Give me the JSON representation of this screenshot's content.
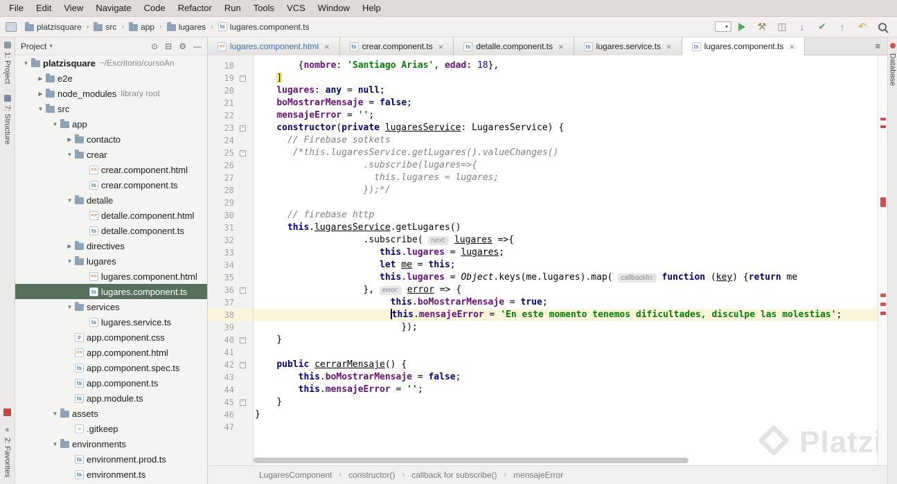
{
  "menu_bar": {
    "items": [
      "File",
      "Edit",
      "View",
      "Navigate",
      "Code",
      "Refactor",
      "Run",
      "Tools",
      "VCS",
      "Window",
      "Help"
    ]
  },
  "nav_bar": {
    "breadcrumbs": [
      {
        "label": "platzisquare",
        "icon": "folder"
      },
      {
        "label": "src",
        "icon": "folder"
      },
      {
        "label": "app",
        "icon": "folder"
      },
      {
        "label": "lugares",
        "icon": "folder"
      },
      {
        "label": "lugares.component.ts",
        "icon": "ts"
      }
    ],
    "toolbar_icons": [
      "run-config-dropdown",
      "run",
      "build-hammer",
      "open-recent",
      "vcs-update",
      "vcs-commit",
      "vcs-push",
      "rollback",
      "search-everywhere"
    ]
  },
  "left_stripe": {
    "top": [
      {
        "id": "project",
        "label": "1: Project"
      },
      {
        "id": "structure",
        "label": "7: Structure"
      }
    ],
    "bottom": [
      {
        "id": "npm",
        "label": ""
      },
      {
        "id": "favorites",
        "label": "2: Favorites"
      }
    ]
  },
  "right_stripe": {
    "top": [
      {
        "id": "database",
        "label": "Database"
      }
    ]
  },
  "project_panel": {
    "title": "Project",
    "header_icons": [
      "locate",
      "collapse-all",
      "settings-gear",
      "hide"
    ],
    "tree": [
      {
        "label": "platzisquare",
        "suffix": "~/Escritorio/cursoAn",
        "depth": 0,
        "icon": "folder",
        "arrow": "open",
        "bold": true
      },
      {
        "label": "e2e",
        "depth": 1,
        "icon": "folder",
        "arrow": "closed"
      },
      {
        "label": "node_modules",
        "suffix": "library root",
        "depth": 1,
        "icon": "folder",
        "arrow": "closed"
      },
      {
        "label": "src",
        "depth": 1,
        "icon": "folder",
        "arrow": "open"
      },
      {
        "label": "app",
        "depth": 2,
        "icon": "folder",
        "arrow": "open"
      },
      {
        "label": "contacto",
        "depth": 3,
        "icon": "folder",
        "arrow": "closed"
      },
      {
        "label": "crear",
        "depth": 3,
        "icon": "folder",
        "arrow": "open"
      },
      {
        "label": "crear.component.html",
        "depth": 4,
        "icon": "html"
      },
      {
        "label": "crear.component.ts",
        "depth": 4,
        "icon": "ts"
      },
      {
        "label": "detalle",
        "depth": 3,
        "icon": "folder",
        "arrow": "open"
      },
      {
        "label": "detalle.component.html",
        "depth": 4,
        "icon": "html"
      },
      {
        "label": "detalle.component.ts",
        "depth": 4,
        "icon": "ts"
      },
      {
        "label": "directives",
        "depth": 3,
        "icon": "folder",
        "arrow": "closed"
      },
      {
        "label": "lugares",
        "depth": 3,
        "icon": "folder",
        "arrow": "open"
      },
      {
        "label": "lugares.component.html",
        "depth": 4,
        "icon": "html"
      },
      {
        "label": "lugares.component.ts",
        "depth": 4,
        "icon": "ts",
        "selected": true
      },
      {
        "label": "services",
        "depth": 3,
        "icon": "folder",
        "arrow": "open"
      },
      {
        "label": "lugares.service.ts",
        "depth": 4,
        "icon": "ts"
      },
      {
        "label": "app.component.css",
        "depth": 3,
        "icon": "css"
      },
      {
        "label": "app.component.html",
        "depth": 3,
        "icon": "html"
      },
      {
        "label": "app.component.spec.ts",
        "depth": 3,
        "icon": "ts"
      },
      {
        "label": "app.component.ts",
        "depth": 3,
        "icon": "ts"
      },
      {
        "label": "app.module.ts",
        "depth": 3,
        "icon": "ts"
      },
      {
        "label": "assets",
        "depth": 2,
        "icon": "folder",
        "arrow": "open"
      },
      {
        "label": ".gitkeep",
        "depth": 3,
        "icon": "file"
      },
      {
        "label": "environments",
        "depth": 2,
        "icon": "folder",
        "arrow": "open"
      },
      {
        "label": "environment.prod.ts",
        "depth": 3,
        "icon": "ts"
      },
      {
        "label": "environment.ts",
        "depth": 3,
        "icon": "ts"
      }
    ]
  },
  "editor_tabs": [
    {
      "label": "lugares.component.html",
      "icon": "html",
      "modified": true,
      "active": false
    },
    {
      "label": "crear.component.ts",
      "icon": "ts",
      "modified": false,
      "active": false
    },
    {
      "label": "detalle.component.ts",
      "icon": "ts",
      "modified": false,
      "active": false
    },
    {
      "label": "lugares.service.ts",
      "icon": "ts",
      "modified": false,
      "active": false
    },
    {
      "label": "lugares.component.ts",
      "icon": "ts",
      "modified": false,
      "active": true
    }
  ],
  "editor": {
    "first_line": 18,
    "current_line": 38,
    "fold_marker_lines": [
      19,
      23,
      25,
      36,
      40,
      42,
      45
    ],
    "stripe_marks": [
      {
        "t": 90,
        "h": 4
      },
      {
        "t": 101,
        "h": 4
      },
      {
        "t": 205,
        "h": 14
      },
      {
        "t": 344,
        "h": 5
      },
      {
        "t": 357,
        "h": 5
      },
      {
        "t": 370,
        "h": 5
      }
    ],
    "lines": [
      {
        "n": 18,
        "i": 8,
        "t": [
          [
            "{",
            ""
          ],
          [
            "nombre",
            "f"
          ],
          [
            ": ",
            ""
          ],
          [
            "'Santiago Arias'",
            "s"
          ],
          [
            ", ",
            ""
          ],
          [
            "edad",
            "f"
          ],
          [
            ": ",
            ""
          ],
          [
            "18",
            "n"
          ],
          [
            "},",
            ""
          ]
        ]
      },
      {
        "n": 19,
        "i": 4,
        "t": [
          [
            "]",
            "m"
          ]
        ]
      },
      {
        "n": 20,
        "i": 4,
        "t": [
          [
            "lugares",
            "f"
          ],
          [
            ": ",
            ""
          ],
          [
            "any",
            "k"
          ],
          [
            " = ",
            ""
          ],
          [
            "null",
            "k"
          ],
          [
            ";",
            ""
          ]
        ]
      },
      {
        "n": 21,
        "i": 4,
        "t": [
          [
            "boMostrarMensaje",
            "f"
          ],
          [
            " = ",
            ""
          ],
          [
            "false",
            "k"
          ],
          [
            ";",
            ""
          ]
        ]
      },
      {
        "n": 22,
        "i": 4,
        "t": [
          [
            "mensajeError",
            "f"
          ],
          [
            " = ",
            ""
          ],
          [
            "''",
            "s"
          ],
          [
            ";",
            ""
          ]
        ]
      },
      {
        "n": 23,
        "i": 4,
        "t": [
          [
            "constructor",
            "k"
          ],
          [
            "(",
            ""
          ],
          [
            "private ",
            "k"
          ],
          [
            "lugaresService",
            "u"
          ],
          [
            ": LugaresService) {",
            ""
          ]
        ]
      },
      {
        "n": 24,
        "i": 6,
        "t": [
          [
            "// Firebase sotkets",
            "c"
          ]
        ]
      },
      {
        "n": 25,
        "i": 7,
        "t": [
          [
            "/*this.lugaresService.getLugares().valueChanges()",
            "c"
          ]
        ]
      },
      {
        "n": 26,
        "i": 20,
        "t": [
          [
            ".subscribe(lugares=>{",
            "c"
          ]
        ]
      },
      {
        "n": 27,
        "i": 22,
        "t": [
          [
            "this.lugares = lugares;",
            "c"
          ]
        ]
      },
      {
        "n": 28,
        "i": 20,
        "t": [
          [
            "});*/",
            "c"
          ]
        ]
      },
      {
        "n": 29,
        "i": 0,
        "t": []
      },
      {
        "n": 30,
        "i": 6,
        "t": [
          [
            "// firebase http",
            "c"
          ]
        ]
      },
      {
        "n": 31,
        "i": 6,
        "t": [
          [
            "this",
            "k"
          ],
          [
            ".",
            ""
          ],
          [
            "lugaresService",
            "u"
          ],
          [
            ".getLugares()",
            ""
          ]
        ]
      },
      {
        "n": 32,
        "i": 20,
        "t": [
          [
            ".subscribe( ",
            ""
          ],
          [
            "next:",
            "h"
          ],
          [
            " ",
            ""
          ],
          [
            "lugares",
            "u"
          ],
          [
            " =>{",
            ""
          ]
        ]
      },
      {
        "n": 33,
        "i": 23,
        "t": [
          [
            "this",
            "k"
          ],
          [
            ".",
            ""
          ],
          [
            "lugares",
            "f"
          ],
          [
            " = ",
            ""
          ],
          [
            "lugares",
            "u"
          ],
          [
            ";",
            ""
          ]
        ]
      },
      {
        "n": 34,
        "i": 23,
        "t": [
          [
            "let ",
            "k"
          ],
          [
            "me",
            "u"
          ],
          [
            " = ",
            ""
          ],
          [
            "this",
            "k"
          ],
          [
            ";",
            ""
          ]
        ]
      },
      {
        "n": 35,
        "i": 23,
        "t": [
          [
            "this",
            "k"
          ],
          [
            ".",
            ""
          ],
          [
            "lugares",
            "f"
          ],
          [
            " = ",
            ""
          ],
          [
            "Object",
            "i"
          ],
          [
            ".keys(me.lugares).map( ",
            ""
          ],
          [
            "callbackfn:",
            "h"
          ],
          [
            " ",
            ""
          ],
          [
            "function",
            "k"
          ],
          [
            " (",
            ""
          ],
          [
            "key",
            "u"
          ],
          [
            ") {",
            ""
          ],
          [
            "return",
            "k"
          ],
          [
            " me",
            ""
          ]
        ]
      },
      {
        "n": 36,
        "i": 20,
        "t": [
          [
            "}, ",
            ""
          ],
          [
            "error:",
            "h"
          ],
          [
            " ",
            ""
          ],
          [
            "error",
            "u"
          ],
          [
            " => {",
            ""
          ]
        ]
      },
      {
        "n": 37,
        "i": 25,
        "t": [
          [
            "this",
            "k"
          ],
          [
            ".",
            ""
          ],
          [
            "boMostrarMensaje",
            "f"
          ],
          [
            " = ",
            ""
          ],
          [
            "true",
            "k"
          ],
          [
            ";",
            ""
          ]
        ]
      },
      {
        "n": 38,
        "i": 25,
        "t": [
          [
            "",
            "caret"
          ],
          [
            "this",
            "k"
          ],
          [
            ".",
            ""
          ],
          [
            "mensajeError",
            "f"
          ],
          [
            " = ",
            ""
          ],
          [
            "'En este momento tenemos dificultades, disculpe las molestias'",
            "s"
          ],
          [
            ";",
            ""
          ]
        ]
      },
      {
        "n": 39,
        "i": 27,
        "t": [
          [
            "});",
            ""
          ]
        ]
      },
      {
        "n": 40,
        "i": 4,
        "t": [
          [
            "}",
            ""
          ]
        ]
      },
      {
        "n": 41,
        "i": 0,
        "t": []
      },
      {
        "n": 42,
        "i": 4,
        "t": [
          [
            "public ",
            "k"
          ],
          [
            "cerrarMensaje",
            "u"
          ],
          [
            "() {",
            ""
          ]
        ]
      },
      {
        "n": 43,
        "i": 8,
        "t": [
          [
            "this",
            "k"
          ],
          [
            ".",
            ""
          ],
          [
            "boMostrarMensaje",
            "f"
          ],
          [
            " = ",
            ""
          ],
          [
            "false",
            "k"
          ],
          [
            ";",
            ""
          ]
        ]
      },
      {
        "n": 44,
        "i": 8,
        "t": [
          [
            "this",
            "k"
          ],
          [
            ".",
            ""
          ],
          [
            "mensajeError",
            "f"
          ],
          [
            " = ",
            ""
          ],
          [
            "''",
            "s"
          ],
          [
            ";",
            ""
          ]
        ]
      },
      {
        "n": 45,
        "i": 4,
        "t": [
          [
            "}",
            ""
          ]
        ]
      },
      {
        "n": 46,
        "i": 0,
        "t": [
          [
            "}",
            ""
          ]
        ]
      },
      {
        "n": 47,
        "i": 0,
        "t": []
      }
    ]
  },
  "bottom_breadcrumbs": [
    "LugaresComponent",
    "constructor()",
    "callback for subscribe()",
    "mensajeError"
  ],
  "watermark": {
    "text": "Platzi"
  },
  "colors": {
    "selection": "#55715c",
    "current_line": "#fbf5dc",
    "error": "#d05050",
    "run_green": "#59a869",
    "keyword": "#000080",
    "string": "#008000",
    "number": "#0000ff",
    "comment": "#808080",
    "field": "#660e7a"
  }
}
